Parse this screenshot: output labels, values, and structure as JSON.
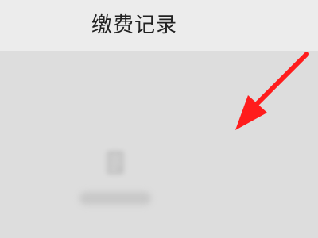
{
  "header": {
    "title": "缴费记录"
  },
  "empty_state": {
    "icon": "document-icon",
    "message": ""
  },
  "annotation": {
    "icon": "red-arrow-icon",
    "color": "#ff1c1c"
  },
  "colors": {
    "nav_background": "#ececec",
    "content_background": "#dddddd",
    "title_text": "#222222"
  }
}
